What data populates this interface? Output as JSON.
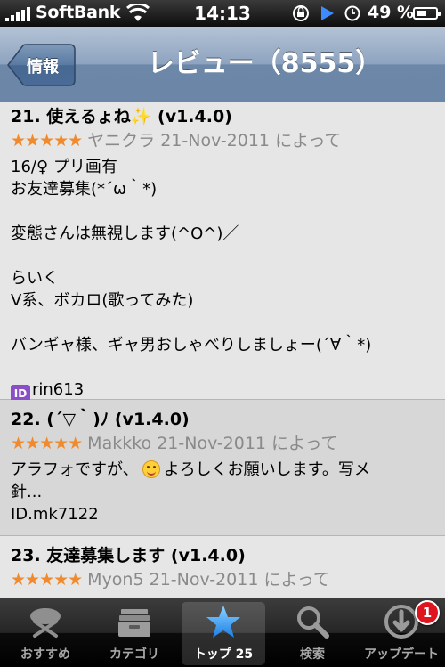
{
  "status_bar": {
    "carrier": "SoftBank",
    "time": "14:13",
    "battery": "49 %"
  },
  "nav": {
    "back_label": "情報",
    "title": "レビュー（8555）"
  },
  "reviews": [
    {
      "title": "21. 使えるょね",
      "version": "(v1.4.0)",
      "stars": "★★★★★",
      "meta": "ヤニクラ 21-Nov-2011 によって",
      "lines": [
        "16/♀ プリ画有",
        "お友達募集(*´ω｀*)",
        "",
        "変態さんは無視します(^O^)／",
        "",
        "らいく",
        "V系、ボカロ(歌ってみた)",
        "",
        "バンギャ様、ギャ男おしゃべりしましょー(´∀｀*)",
        ""
      ],
      "id_icon_text": "ID",
      "id_line": "rin613"
    },
    {
      "title": "22. (´▽｀)ﾉ",
      "version": "(v1.4.0)",
      "stars": "★★★★★",
      "meta": "Makkko 21-Nov-2011 によって",
      "line1_a": "アラフォですが、",
      "line1_b": "よろしくお願いします。写メ",
      "line2": "針...",
      "line3": "ID.mk7122"
    },
    {
      "title": "23. 友達募集します",
      "version": "(v1.4.0)",
      "stars": "★★★★★",
      "meta": "Myon5 21-Nov-2011 によって"
    }
  ],
  "tabs": [
    {
      "label": "おすすめ",
      "icon": "featured-icon"
    },
    {
      "label": "カテゴリ",
      "icon": "categories-icon"
    },
    {
      "label": "トップ 25",
      "icon": "star-icon",
      "selected": true
    },
    {
      "label": "検索",
      "icon": "search-icon"
    },
    {
      "label": "アップデート",
      "icon": "updates-icon",
      "badge": "1"
    }
  ]
}
